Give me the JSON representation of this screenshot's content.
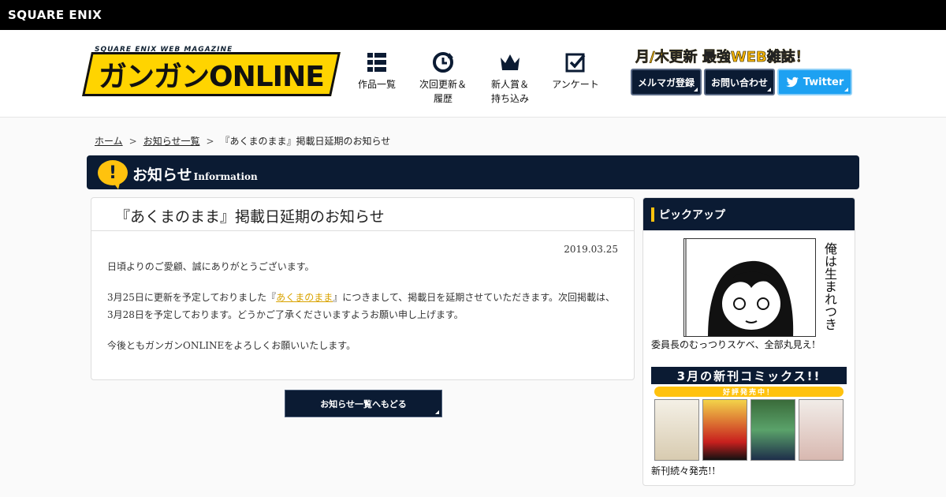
{
  "topbar": {
    "brand": "SQUARE ENIX"
  },
  "header": {
    "logo_sub": "SQUARE ENIX WEB MAGAZINE",
    "logo_main": "ガンガンONLINE",
    "nav": [
      {
        "label": "作品一覧",
        "icon": "grid-icon"
      },
      {
        "label": "次回更新＆\n履歴",
        "icon": "clock-refresh-icon"
      },
      {
        "label": "新人賞＆\n持ち込み",
        "icon": "crown-icon"
      },
      {
        "label": "アンケート",
        "icon": "checkbox-icon"
      }
    ],
    "tagline": "月/木更新 最強WEB雑誌！",
    "buttons": {
      "mail": "メルマガ登録",
      "contact": "お問い合わせ",
      "twitter": "Twitter"
    }
  },
  "breadcrumb": {
    "home": "ホーム",
    "news": "お知らせ一覧",
    "current": "『あくまのまま』掲載日延期のお知らせ"
  },
  "banner": {
    "title": "お知らせ",
    "subtitle": "Information"
  },
  "article": {
    "title": "『あくまのまま』掲載日延期のお知らせ",
    "date": "2019.03.25",
    "p1": "日頃よりのご愛顧、誠にありがとうございます。",
    "p2_before": "3月25日に更新を予定しておりました『",
    "p2_link": "あくまのまま",
    "p2_after": "』につきまして、掲載日を延期させていただきます。次回掲載は、3月28日を予定しております。どうかご了承くださいますようお願い申し上げます。",
    "p3": "今後ともガンガンONLINEをよろしくお願いいたします。"
  },
  "back_button": "お知らせ一覧へもどる",
  "sidebar": {
    "heading": "ピックアップ",
    "pick1_vertical": "俺は生まれつき",
    "pick1_caption": "委員長のむっつりスケベ、全部丸見え!",
    "promo_title": "3月の新刊コミックス!!",
    "promo_badge": "好評発売中！",
    "promo_caption": "新刊続々発売!!"
  },
  "colors": {
    "navy": "#0b1b33",
    "accent_yellow": "#ffc20e",
    "twitter_blue": "#1da1f2",
    "link_gold": "#d9a300"
  }
}
